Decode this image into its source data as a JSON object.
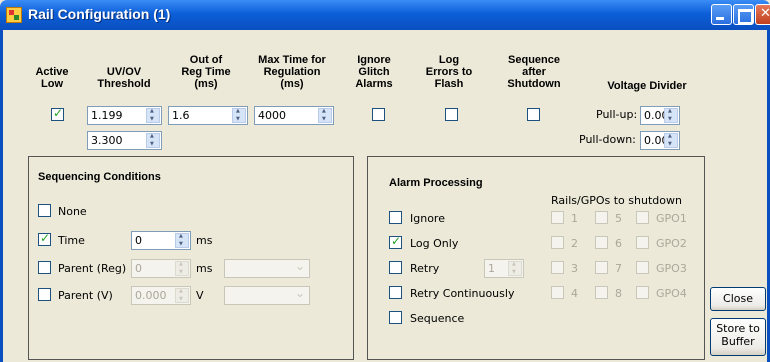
{
  "window": {
    "title": "Rail Configuration (1)"
  },
  "headers": {
    "active_low": "Active\nLow",
    "uvov": "UV/OV\nThreshold",
    "out_of_reg": "Out of\nReg Time\n(ms)",
    "max_time": "Max Time for\nRegulation\n(ms)",
    "ignore_glitch": "Ignore\nGlitch\nAlarms",
    "log_errors": "Log\nErrors to\nFlash",
    "sequence_after": "Sequence\nafter\nShutdown",
    "voltage_divider": "Voltage Divider"
  },
  "row": {
    "active_low": true,
    "uv_value": "1.199",
    "ov_value": "3.300",
    "out_of_reg": "1.6",
    "max_time": "4000",
    "ignore_glitch": false,
    "log_errors": false,
    "sequence_after": false,
    "pullup_label": "Pull-up:",
    "pullup_value": "0.00",
    "pulldown_label": "Pull-down:",
    "pulldown_value": "0.00"
  },
  "sequencing": {
    "title": "Sequencing Conditions",
    "none_label": "None",
    "time_label": "Time",
    "time_value": "0",
    "time_unit": "ms",
    "parent_reg_label": "Parent (Reg)",
    "parent_reg_value": "0",
    "parent_reg_unit": "ms",
    "parent_v_label": "Parent (V)",
    "parent_v_value": "0.000",
    "parent_v_unit": "V"
  },
  "alarm": {
    "title": "Alarm Processing",
    "rails_header": "Rails/GPOs to shutdown",
    "ignore_label": "Ignore",
    "log_only_label": "Log Only",
    "retry_label": "Retry",
    "retry_value": "1",
    "retry_cont_label": "Retry Continuously",
    "sequence_label": "Sequence",
    "rails": [
      "1",
      "2",
      "3",
      "4",
      "5",
      "6",
      "7",
      "8"
    ],
    "gpos": [
      "GPO1",
      "GPO2",
      "GPO3",
      "GPO4"
    ]
  },
  "buttons": {
    "close": "Close",
    "store": "Store to\nBuffer"
  }
}
